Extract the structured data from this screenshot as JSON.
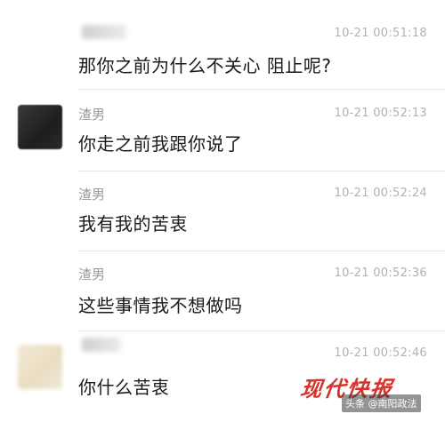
{
  "messages": [
    {
      "sender": "",
      "time": "10-21 00:51:18",
      "text": "那你之前为什么不关心 阻止呢?",
      "avatar": "none"
    },
    {
      "sender": "渣男",
      "time": "10-21 00:52:13",
      "text": "你走之前我跟你说了",
      "avatar": "dark-blurred-avatar"
    },
    {
      "sender": "渣男",
      "time": "10-21 00:52:24",
      "text": "我有我的苦衷",
      "avatar": "none"
    },
    {
      "sender": "渣男",
      "time": "10-21 00:52:36",
      "text": "这些事情我不想做吗",
      "avatar": "none"
    },
    {
      "sender": "",
      "time": "10-21 00:52:46",
      "text": "你什么苦衷",
      "avatar": "light-blurred-avatar"
    }
  ],
  "watermark": {
    "logo_text": "现代快报",
    "source_text": "头条 @南阳政法"
  },
  "colors": {
    "name": "#999999",
    "time": "#b2b2b2",
    "text": "#1a1a1a",
    "divider": "#e5e5e5",
    "watermark_red": "#d4342b"
  }
}
